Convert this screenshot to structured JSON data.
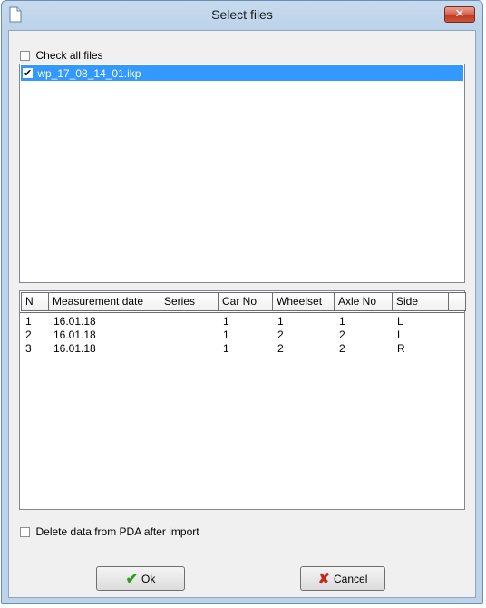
{
  "window": {
    "title": "Select files",
    "close_glyph": "✕"
  },
  "check_all": {
    "label": "Check all files",
    "checked": false
  },
  "files": [
    {
      "name": "wp_17_08_14_01.ikp",
      "checked": true
    }
  ],
  "table": {
    "columns": [
      "N",
      "Measurement date",
      "Series",
      "Car No",
      "Wheelset",
      "Axle No",
      "Side",
      ""
    ],
    "rows": [
      [
        "1",
        "16.01.18",
        "",
        "1",
        "1",
        "1",
        "L"
      ],
      [
        "2",
        "16.01.18",
        "",
        "1",
        "2",
        "2",
        "L"
      ],
      [
        "3",
        "16.01.18",
        "",
        "1",
        "2",
        "2",
        "R"
      ]
    ]
  },
  "delete_option": {
    "label": "Delete data from PDA after import",
    "checked": false
  },
  "buttons": {
    "ok": {
      "label": "Ok",
      "icon": "checkmark-icon"
    },
    "cancel": {
      "label": "Cancel",
      "icon": "x-icon"
    }
  },
  "colors": {
    "selection": "#3399ff",
    "frame": "#bcd3ea",
    "close": "#c23b22"
  }
}
